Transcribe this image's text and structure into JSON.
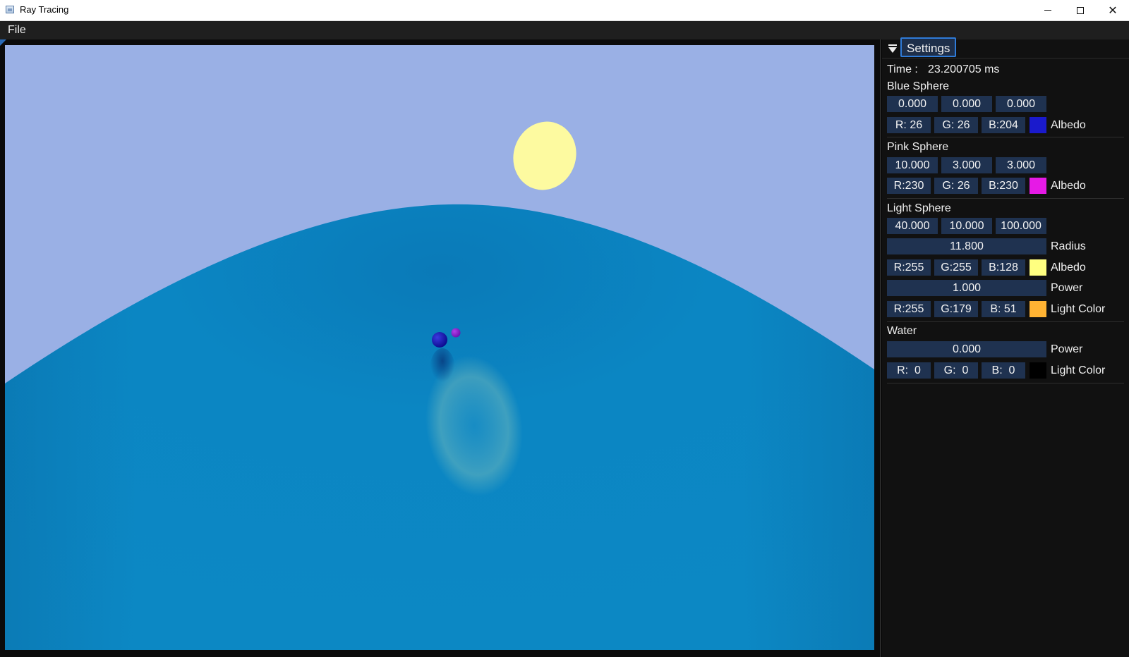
{
  "window": {
    "title": "Ray Tracing"
  },
  "menu": {
    "file": "File"
  },
  "panel": {
    "tab": "Settings",
    "time_label": "Time :",
    "time_value": "23.200705 ms",
    "blue_sphere": {
      "title": "Blue Sphere",
      "position": [
        "0.000",
        "0.000",
        "0.000"
      ],
      "albedo": {
        "r": "R: 26",
        "g": "G: 26",
        "b": "B:204",
        "color": "#1a1acc",
        "label": "Albedo"
      }
    },
    "pink_sphere": {
      "title": "Pink Sphere",
      "position": [
        "10.000",
        "3.000",
        "3.000"
      ],
      "albedo": {
        "r": "R:230",
        "g": "G: 26",
        "b": "B:230",
        "color": "#e61ae6",
        "label": "Albedo"
      }
    },
    "light_sphere": {
      "title": "Light Sphere",
      "position": [
        "40.000",
        "10.000",
        "100.000"
      ],
      "radius": {
        "value": "11.800",
        "label": "Radius"
      },
      "albedo": {
        "r": "R:255",
        "g": "G:255",
        "b": "B:128",
        "color": "#ffff80",
        "label": "Albedo"
      },
      "power": {
        "value": "1.000",
        "label": "Power"
      },
      "light_color": {
        "r": "R:255",
        "g": "G:179",
        "b": "B: 51",
        "color": "#ffb333",
        "label": "Light Color"
      }
    },
    "water": {
      "title": "Water",
      "power": {
        "value": "0.000",
        "label": "Power"
      },
      "light_color": {
        "r": "R:  0",
        "g": "G:  0",
        "b": "B:  0",
        "color": "#000000",
        "label": "Light Color"
      }
    }
  },
  "colors": {
    "sky": "#9ab0e5",
    "water": "#0c87c4",
    "light_sphere": "#fdfaa0",
    "accent": "#2f7bd8"
  }
}
